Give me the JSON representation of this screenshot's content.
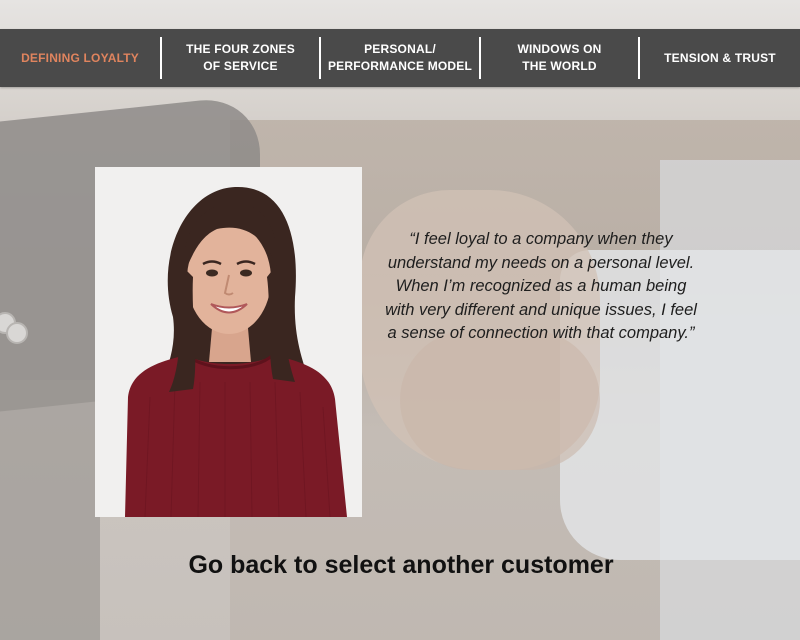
{
  "nav": {
    "items": [
      {
        "label": "DEFINING LOYALTY",
        "active": true
      },
      {
        "label": "THE FOUR ZONES\nOF SERVICE",
        "active": false
      },
      {
        "label": "PERSONAL/\nPERFORMANCE MODEL",
        "active": false
      },
      {
        "label": "WINDOWS ON\nTHE WORLD",
        "active": false
      },
      {
        "label": "TENSION & TRUST",
        "active": false
      }
    ],
    "colors": {
      "bar": "#4a4a4a",
      "text": "#ffffff",
      "active_text": "#e0845e"
    }
  },
  "customer": {
    "quote": "“I feel loyal to a company when they understand my needs on a personal level. When I’m recognized as a human being with very different and unique issues, I feel a sense of connection with that company.”"
  },
  "back_link": {
    "label": "Go back to select another customer"
  }
}
